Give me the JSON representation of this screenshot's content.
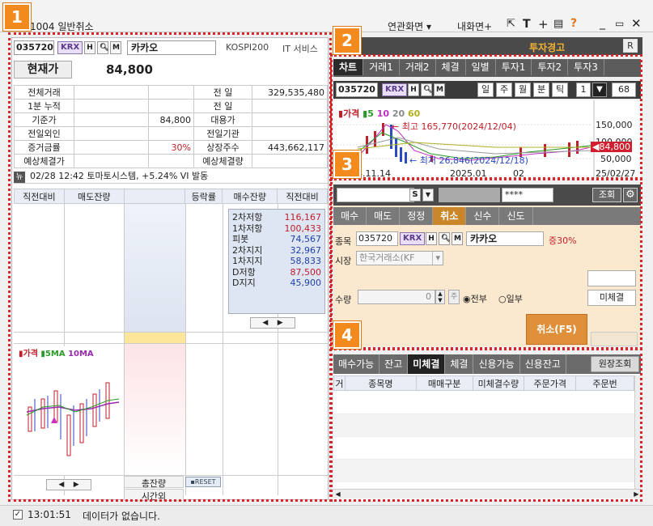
{
  "window": {
    "screen_no": "1004",
    "title": "일반취소",
    "menu_related": "연관화면",
    "menu_my": "내화면+",
    "help": "?"
  },
  "badges": [
    "1",
    "2",
    "3",
    "4"
  ],
  "left": {
    "code": "035720",
    "exchange": "KRX",
    "btn_h": "H",
    "btn_m": "M",
    "stock_name": "카카오",
    "index": "KOSPI200",
    "sector": "IT 서비스",
    "price_label": "현재가",
    "price": "84,800",
    "rows": [
      {
        "l1": "전체거래",
        "v1": "",
        "v1b": "",
        "l2": "전  일",
        "v2": "329,535,480"
      },
      {
        "l1": "1분 누적",
        "v1": "",
        "v1b": "",
        "l2": "전  일",
        "v2": ""
      },
      {
        "l1": "기준가",
        "v1": "",
        "v1b": "84,800",
        "l2": "대용가",
        "v2": ""
      },
      {
        "l1": "전일외인",
        "v1": "",
        "v1b": "",
        "l2": "전일기관",
        "v2": ""
      },
      {
        "l1": "증거금률",
        "v1": "",
        "v1b": "30%",
        "l2": "상장주수",
        "v2": "443,662,117"
      },
      {
        "l1": "예상체결가",
        "v1": "",
        "v1b": "",
        "l2": "예상체결량",
        "v2": ""
      }
    ],
    "news": "02/28 12:42 토마토시스템, +5.24% VI 발동",
    "orderbook_headers": [
      "직전대비",
      "매도잔량",
      "",
      "등락률",
      "매수잔량",
      "직전대비"
    ],
    "pivot": [
      {
        "label": "2차저항",
        "value": "116,167",
        "color": "red"
      },
      {
        "label": "1차저항",
        "value": "100,433",
        "color": "red"
      },
      {
        "label": "피봇",
        "value": "74,567",
        "color": "blue"
      },
      {
        "label": "2차지지",
        "value": "32,967",
        "color": "blue"
      },
      {
        "label": "1차지지",
        "value": "58,833",
        "color": "blue"
      },
      {
        "label": "D저항",
        "value": "87,500",
        "color": "red"
      },
      {
        "label": "D지지",
        "value": "45,900",
        "color": "blue"
      }
    ],
    "mini_chart_legend": {
      "price": "가격",
      "ma5": "5MA",
      "ma10": "10MA"
    },
    "total_label": "총잔량",
    "reset": "RESET",
    "after_hours": "시간외"
  },
  "chart": {
    "warning": "투자경고",
    "r_btn": "R",
    "tabs": [
      "차트",
      "거래1",
      "거래2",
      "체결",
      "일별",
      "투자1",
      "투자2",
      "투자3"
    ],
    "code": "035720",
    "exchange": "KRX",
    "periods": [
      "일",
      "주",
      "월",
      "분",
      "틱"
    ],
    "interval": "1",
    "count": "68",
    "legend": {
      "price": "가격",
      "ma5": "5",
      "ma10": "10",
      "ma20": "20",
      "ma60": "60"
    },
    "high_label": "최고 165,770(2024/12/04)",
    "low_label": "최저 26,846(2024/12/18)",
    "y_ticks": [
      "150,000",
      "100,000",
      "50,000"
    ],
    "current": "84,800",
    "x_ticks": [
      "2024.11.14",
      "2025.01",
      "02",
      "25/02/27"
    ]
  },
  "order": {
    "account_type": "S",
    "password": "****",
    "query": "조회",
    "tabs": [
      "매수",
      "매도",
      "정정",
      "취소",
      "신수",
      "신도"
    ],
    "active_tab": "취소",
    "code_label": "종목",
    "code": "035720",
    "exchange": "KRX",
    "stock_name": "카카오",
    "margin": "증30%",
    "market_label": "시장",
    "market": "한국거래소(KF",
    "qty_label": "수량",
    "qty": "0",
    "all": "전부",
    "partial": "일부",
    "unfilled_btn": "미체결",
    "cancel_btn": "취소(F5)"
  },
  "bottom": {
    "tabs": [
      "매수가능",
      "잔고",
      "미체결",
      "체결",
      "신용가능",
      "신용잔고"
    ],
    "active_tab": "미체결",
    "original": "원장조회",
    "headers": [
      "거",
      "종목명",
      "매매구분",
      "미체결수량",
      "주문가격",
      "주문번"
    ]
  },
  "status": {
    "time": "13:01:51",
    "message": "데이터가 없습니다."
  }
}
